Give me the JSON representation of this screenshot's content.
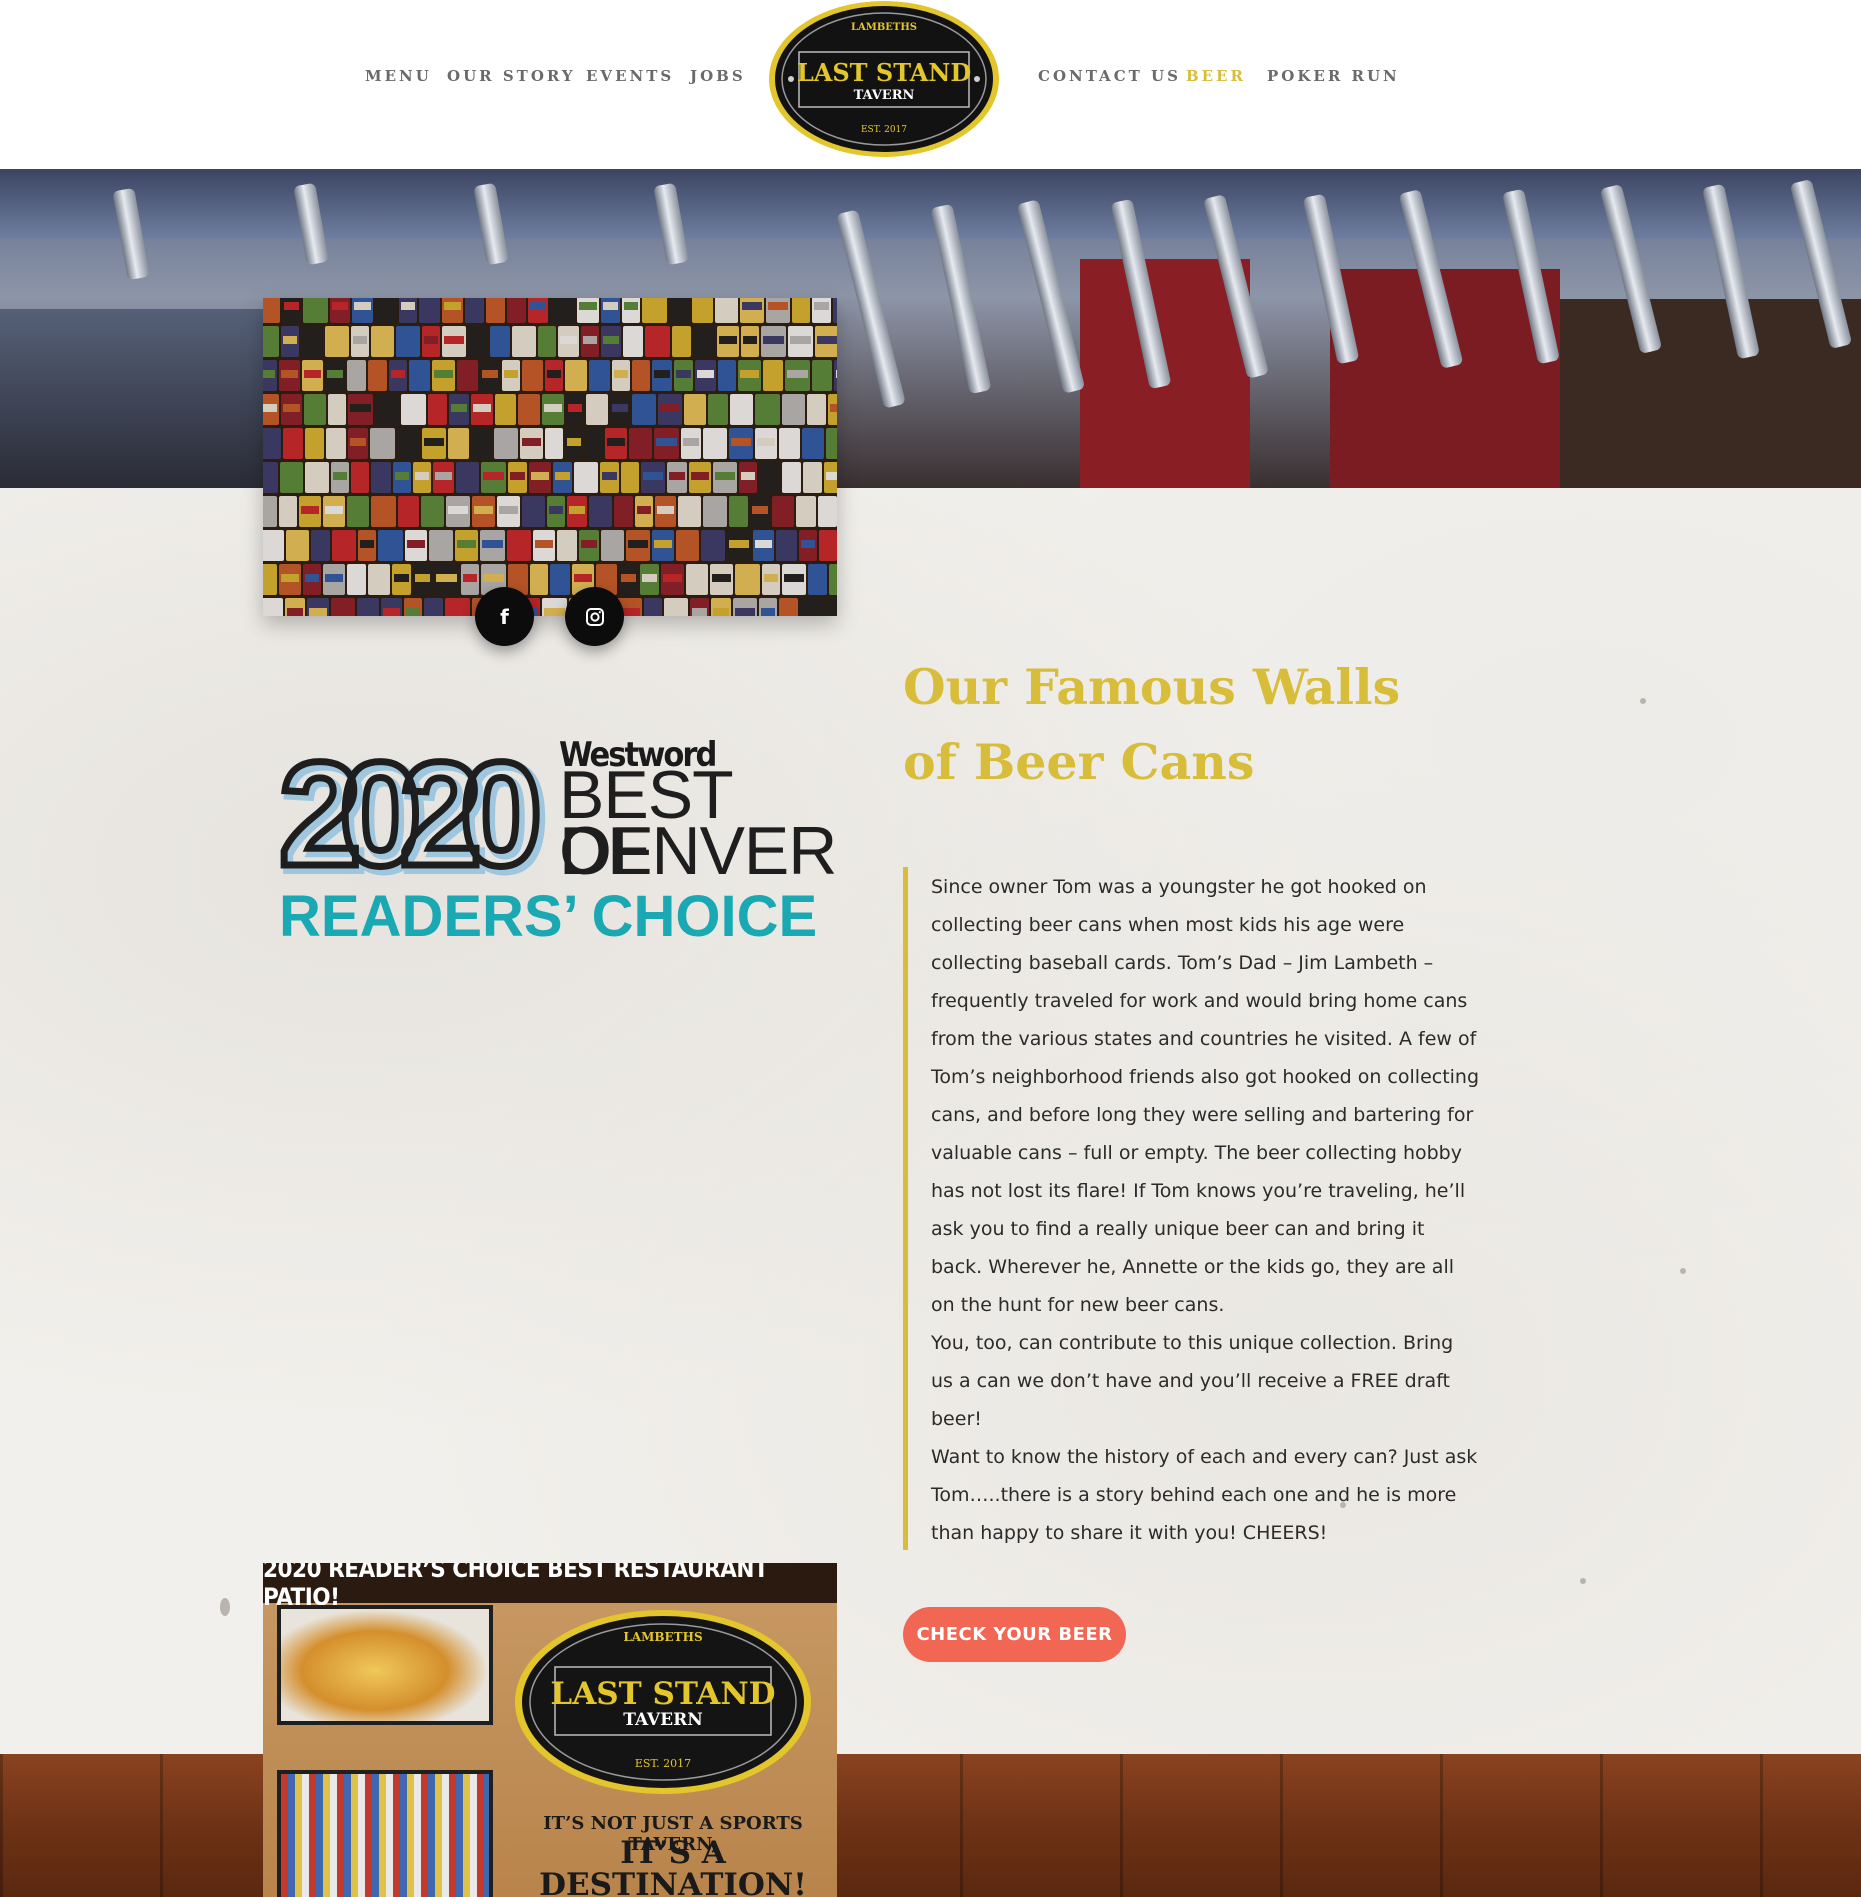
{
  "nav": {
    "left": [
      {
        "label": "MENU"
      },
      {
        "label": "OUR STORY"
      },
      {
        "label": "EVENTS"
      },
      {
        "label": "JOBS"
      }
    ],
    "right": [
      {
        "label": "CONTACT US"
      },
      {
        "label": "BEER"
      },
      {
        "label": "POKER RUN"
      }
    ]
  },
  "logo": {
    "top": "LAMBETHS",
    "main": "LAST STAND",
    "sub": "TAVERN",
    "est": "EST. 2017"
  },
  "award": {
    "year": "2020",
    "publisher": "Westword",
    "line1": "BEST OF",
    "line2": "DENVER",
    "line3": "READERS’ CHOICE"
  },
  "section": {
    "heading": "Our Famous Walls of Beer Cans",
    "paragraphs": [
      "Since owner Tom was a youngster he got hooked on collecting beer cans when most kids his age were collecting baseball cards.  Tom’s Dad – Jim Lambeth – frequently traveled for work and would bring home cans from the various states and countries he visited.  A few of Tom’s neighborhood friends also got hooked on collecting cans, and before long they were selling and bartering for valuable cans – full or empty.  The beer collecting hobby has not lost its flare!  If Tom knows you’re traveling, he’ll ask you to find a really unique beer can and bring it back.  Wherever he, Annette or the kids go, they are all on the hunt for new beer cans.",
      "You, too, can contribute to this unique collection.  Bring us a can we don’t have and you’ll receive a FREE draft beer!",
      "Want to know the history of each and every can?  Just ask Tom…..there is a story behind each one and he is more than happy to share it with you!  CHEERS!"
    ],
    "cta": "CHECK YOUR BEER"
  },
  "social": {
    "facebook": "f",
    "instagram_icon": "instagram-icon"
  },
  "poster": {
    "banner": "2020 READER’S CHOICE BEST RESTAURANT PATIO!",
    "logo_top": "LAMBETHS",
    "logo_main": "LAST STAND",
    "logo_sub": "TAVERN",
    "logo_est": "EST. 2017",
    "tagline1": "IT’S NOT JUST A SPORTS TAVERN,",
    "tagline2a": "IT’S A",
    "tagline2b": "DESTINATION!"
  },
  "colors": {
    "accent_gold": "#d8bd3a",
    "cta": "#f26654",
    "award_teal": "#1aa8b3",
    "nav_gray": "#6a6a6a"
  }
}
